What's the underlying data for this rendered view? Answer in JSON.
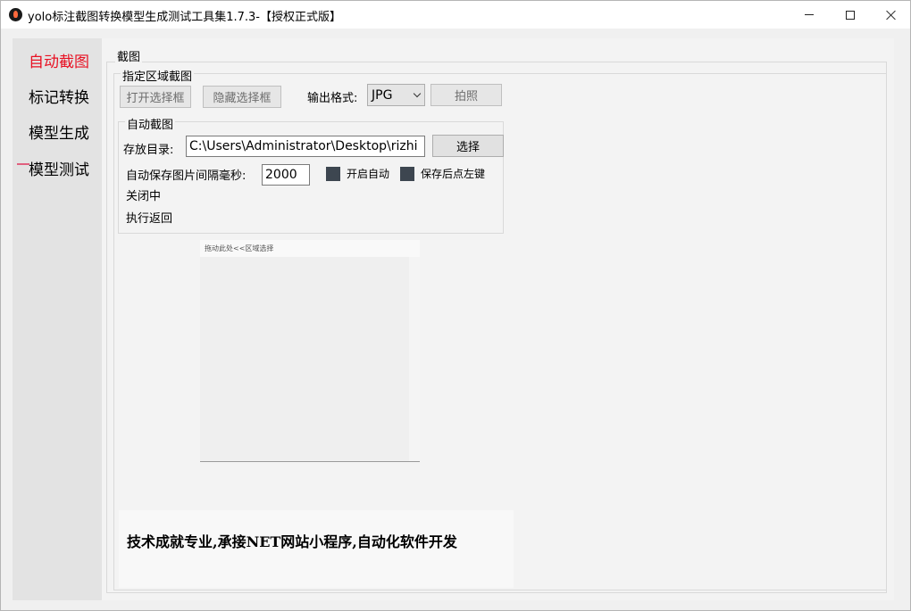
{
  "window": {
    "title": "yolo标注截图转换模型生成测试工具集1.7.3-【授权正式版】"
  },
  "sidebar": {
    "items": [
      {
        "label": "自动截图",
        "active": true
      },
      {
        "label": "标记转换",
        "active": false
      },
      {
        "label": "模型生成",
        "active": false
      },
      {
        "label": "模型测试",
        "active": false
      }
    ]
  },
  "screenshot": {
    "group_title": "截图",
    "region": {
      "title": "指定区域截图",
      "open_label": "打开选择框",
      "hide_label": "隐藏选择框",
      "format_label": "输出格式:",
      "format_value": "JPG",
      "photo_label": "拍照"
    },
    "auto": {
      "title": "自动截图",
      "dir_label": "存放目录:",
      "dir_value": "C:\\Users\\Administrator\\Desktop\\rizhi",
      "select_label": "选择",
      "interval_label": "自动保存图片间隔毫秒:",
      "interval_value": "2000",
      "auto_on_label": "开启自动",
      "left_click_label": "保存后点左键",
      "status": "关闭中",
      "back_label": "执行返回"
    },
    "preview": {
      "header": "拖动此处<<区域选择"
    },
    "footer": "技术成就专业,承接NET网站小程序,自动化软件开发"
  },
  "colors": {
    "active_nav": "#e81123",
    "checkbox": "#3d4650",
    "sidebar_bg": "#e3e3e3"
  }
}
